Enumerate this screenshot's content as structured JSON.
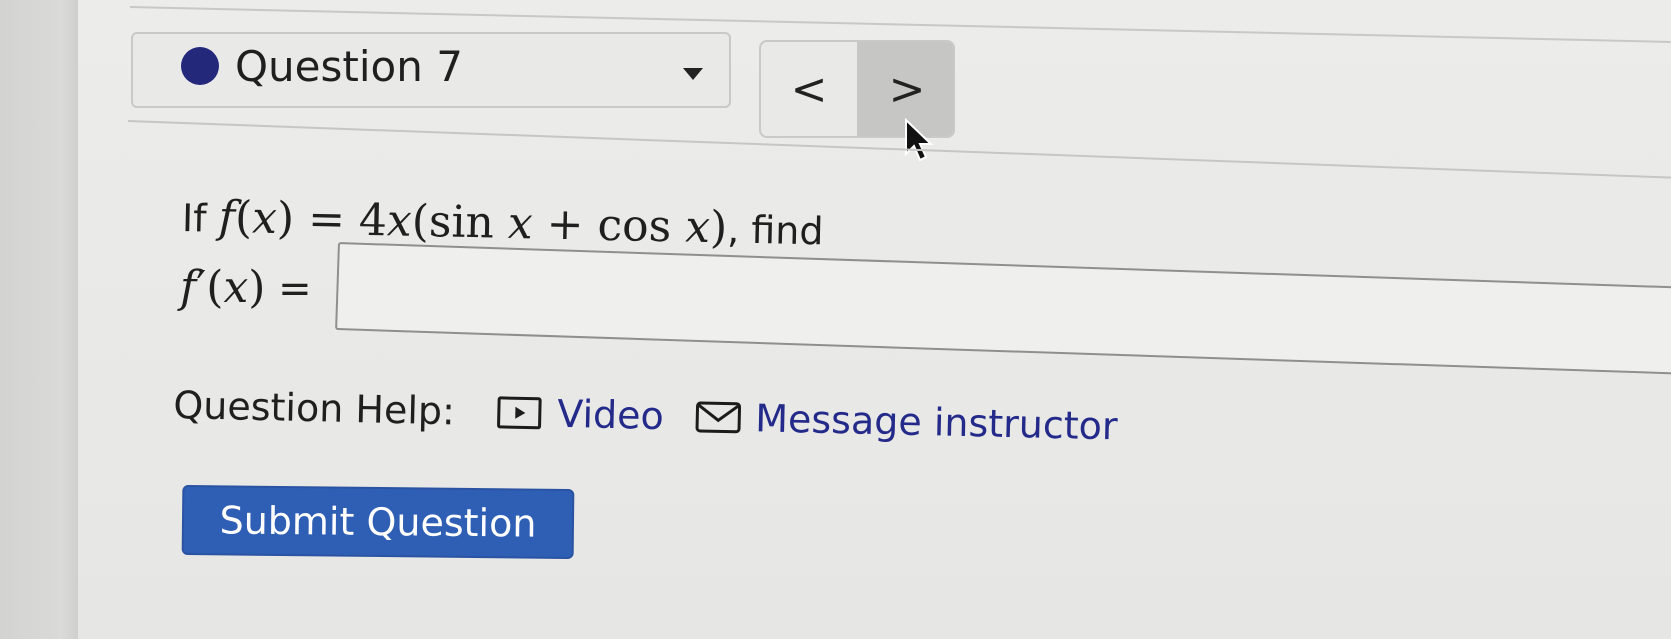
{
  "question_selector": {
    "label": "Question 7",
    "dot_color": "#23287a"
  },
  "nav": {
    "prev_label": "<",
    "next_label": ">"
  },
  "problem": {
    "prefix": "If",
    "suffix": ", find"
  },
  "answer": {
    "label_suffix": " =",
    "value": ""
  },
  "help": {
    "label": "Question Help:",
    "video_label": "Video",
    "message_label": "Message instructor",
    "link_color": "#232a8a"
  },
  "submit": {
    "label": "Submit Question",
    "color": "#2f5fb4"
  }
}
